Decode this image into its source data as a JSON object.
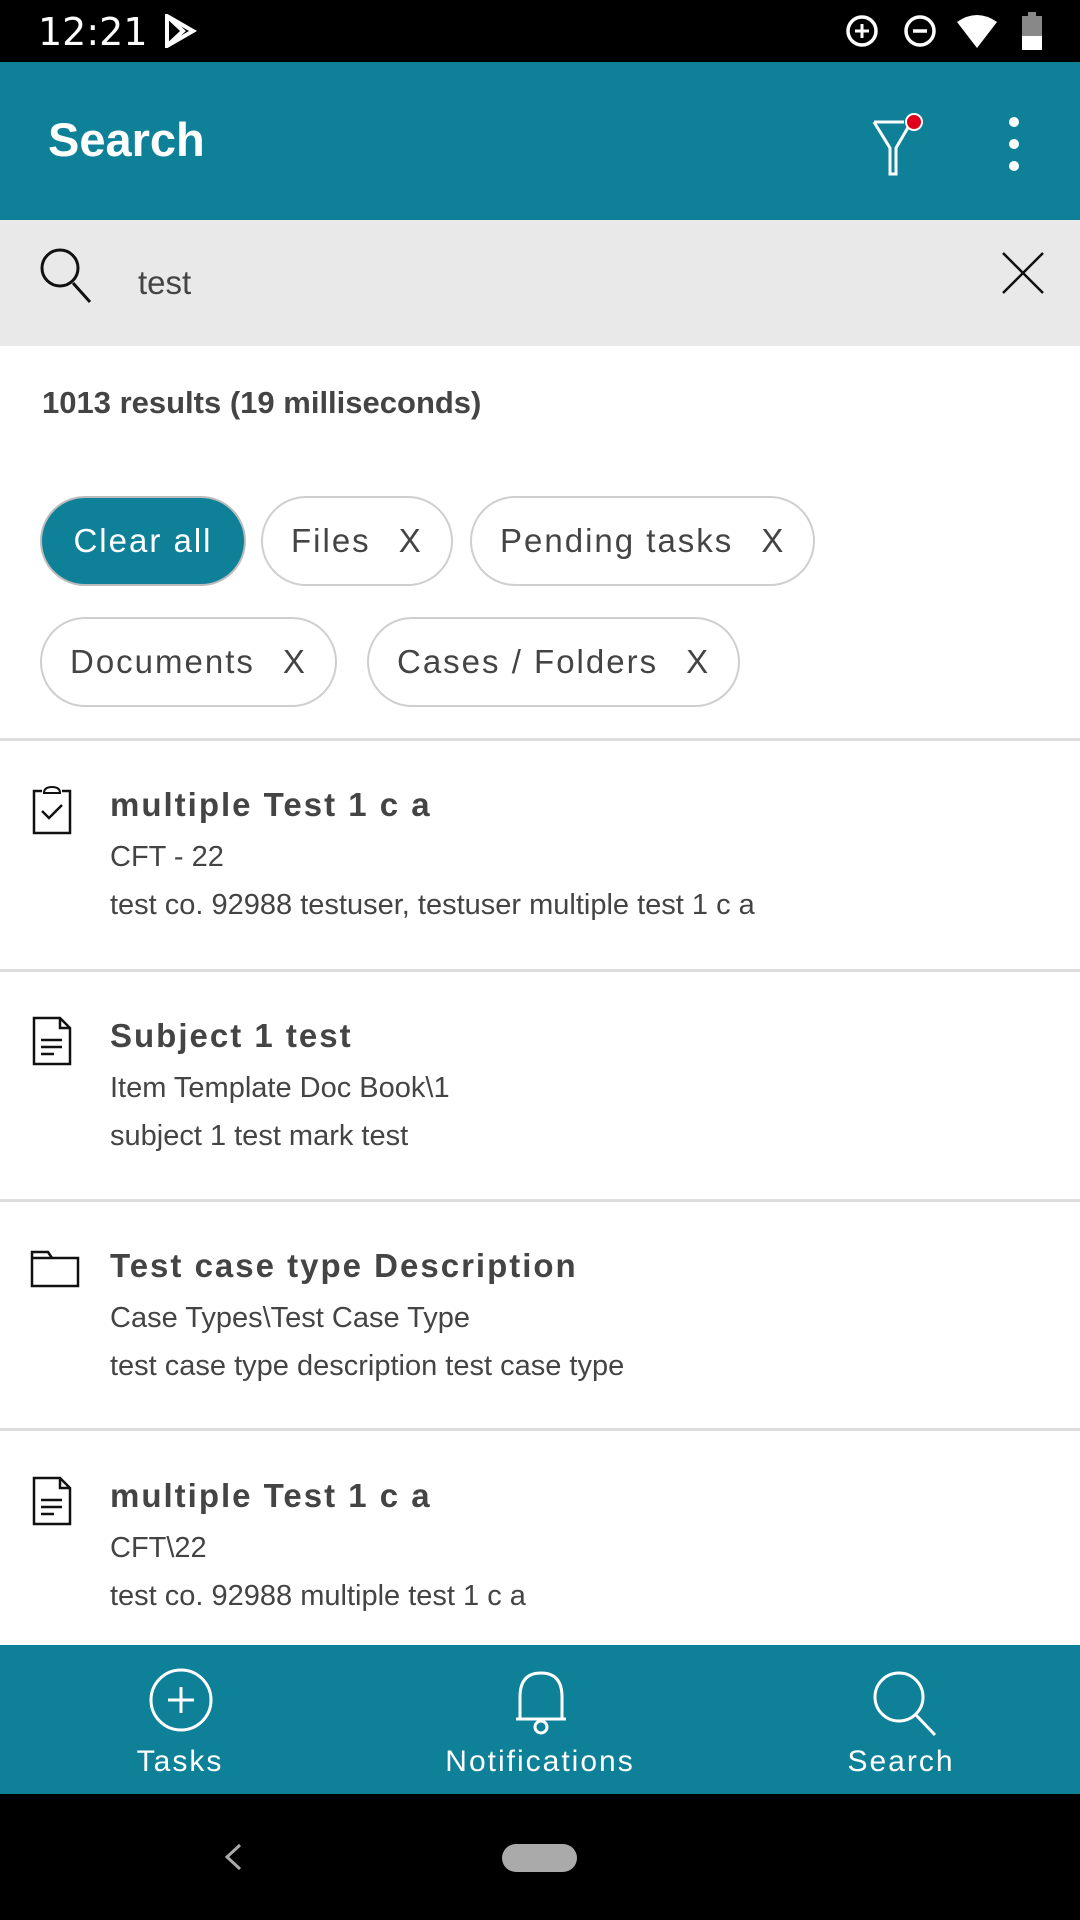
{
  "status_bar": {
    "time": "12:21"
  },
  "header": {
    "title": "Search"
  },
  "search": {
    "value": "test"
  },
  "results_summary": "1013 results (19 milliseconds)",
  "chips": [
    {
      "label": "Clear all"
    },
    {
      "label": "Files",
      "remove": "X"
    },
    {
      "label": "Pending tasks",
      "remove": "X"
    },
    {
      "label": "Documents",
      "remove": "X"
    },
    {
      "label": "Cases / Folders",
      "remove": "X"
    }
  ],
  "results": [
    {
      "icon": "task-clipboard-icon",
      "title": "multiple Test 1 c a",
      "line1": "CFT - 22",
      "line2": "test co. 92988 testuser, testuser multiple test 1 c a"
    },
    {
      "icon": "document-icon",
      "title": "Subject 1 test",
      "line1": "Item Template Doc Book\\1",
      "line2": "subject 1 test mark test"
    },
    {
      "icon": "folder-icon",
      "title": "Test case type Description",
      "line1": "Case Types\\Test Case Type",
      "line2": "test case type description test case type"
    },
    {
      "icon": "document-icon",
      "title": "multiple Test 1 c a",
      "line1": "CFT\\22",
      "line2": "test co. 92988 multiple test 1 c a"
    }
  ],
  "bottom_nav": [
    {
      "label": "Tasks"
    },
    {
      "label": "Notifications"
    },
    {
      "label": "Search"
    }
  ],
  "colors": {
    "primary": "#0e8199",
    "filter_badge": "#e0001b"
  }
}
